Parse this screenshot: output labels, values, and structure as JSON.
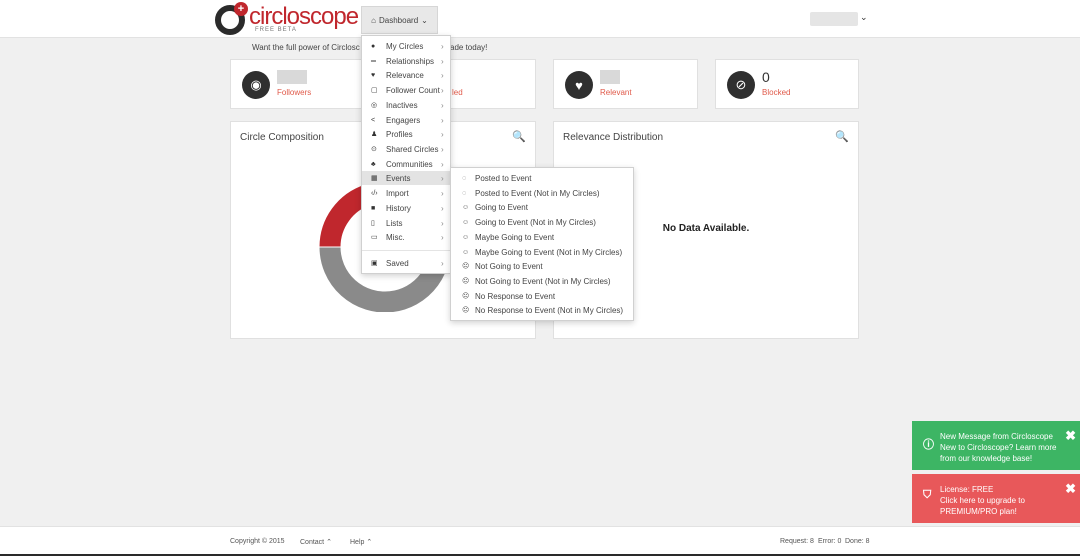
{
  "header": {
    "logo_text": "circloscope",
    "logo_sub": "FREE BETA",
    "dashboard_label": "Dashboard"
  },
  "promo": {
    "left": "Want the full power of Circlosc",
    "right": "ade today!"
  },
  "stats": [
    {
      "icon": "eye-icon",
      "value": "",
      "label": "Followers"
    },
    {
      "icon": "ban-icon",
      "value": "",
      "label": "led"
    },
    {
      "icon": "heart-icon",
      "value": "",
      "label": "Relevant"
    },
    {
      "icon": "blocked-icon",
      "value": "0",
      "label": "Blocked"
    }
  ],
  "panels": {
    "circle_title": "Circle Composition",
    "relevance_title": "Relevance Distribution",
    "no_data": "No Data Available."
  },
  "chart_data": {
    "type": "pie",
    "title": "Circle Composition",
    "labels": [
      "",
      ""
    ],
    "values": [
      20,
      80
    ],
    "colors": [
      "#c0272d",
      "#8a8a8a"
    ],
    "note_hidden": false
  },
  "menu": {
    "items": [
      {
        "icon": "circle-icon",
        "label": "My Circles"
      },
      {
        "icon": "relationships-icon",
        "label": "Relationships"
      },
      {
        "icon": "heart-icon",
        "label": "Relevance"
      },
      {
        "icon": "square-icon",
        "label": "Follower Count"
      },
      {
        "icon": "inactive-icon",
        "label": "Inactives"
      },
      {
        "icon": "share-icon",
        "label": "Engagers"
      },
      {
        "icon": "user-icon",
        "label": "Profiles"
      },
      {
        "icon": "shared-circle-icon",
        "label": "Shared Circles"
      },
      {
        "icon": "users-icon",
        "label": "Communities"
      },
      {
        "icon": "calendar-icon",
        "label": "Events"
      },
      {
        "icon": "code-icon",
        "label": "Import"
      },
      {
        "icon": "book-icon",
        "label": "History"
      },
      {
        "icon": "file-icon",
        "label": "Lists"
      },
      {
        "icon": "folder-icon",
        "label": "Misc."
      }
    ],
    "saved_label": "Saved"
  },
  "events_submenu": [
    "Posted to Event",
    "Posted to Event (Not in My Circles)",
    "Going to Event",
    "Going to Event (Not in My Circles)",
    "Maybe Going to Event",
    "Maybe Going to Event (Not in My Circles)",
    "Not Going to Event",
    "Not Going to Event (Not in My Circles)",
    "No Response to Event",
    "No Response to Event (Not in My Circles)"
  ],
  "toasts": {
    "green": {
      "title": "New Message from Circloscope",
      "line2": "New to Circloscope? Learn more",
      "line3": "from our knowledge base!"
    },
    "red": {
      "title": "License: FREE",
      "line2": "Click here to upgrade to",
      "line3": "PREMIUM/PRO plan!"
    }
  },
  "footer": {
    "copyright": "Copyright © 2015",
    "contact": "Contact",
    "help": "Help",
    "request": "Request: 8",
    "error": "Error: 0",
    "done": "Done: 8"
  },
  "colors": {
    "brand_red": "#c0272d",
    "toast_green": "#3db564",
    "toast_red": "#e8585a",
    "label_red": "#e05a4a"
  }
}
